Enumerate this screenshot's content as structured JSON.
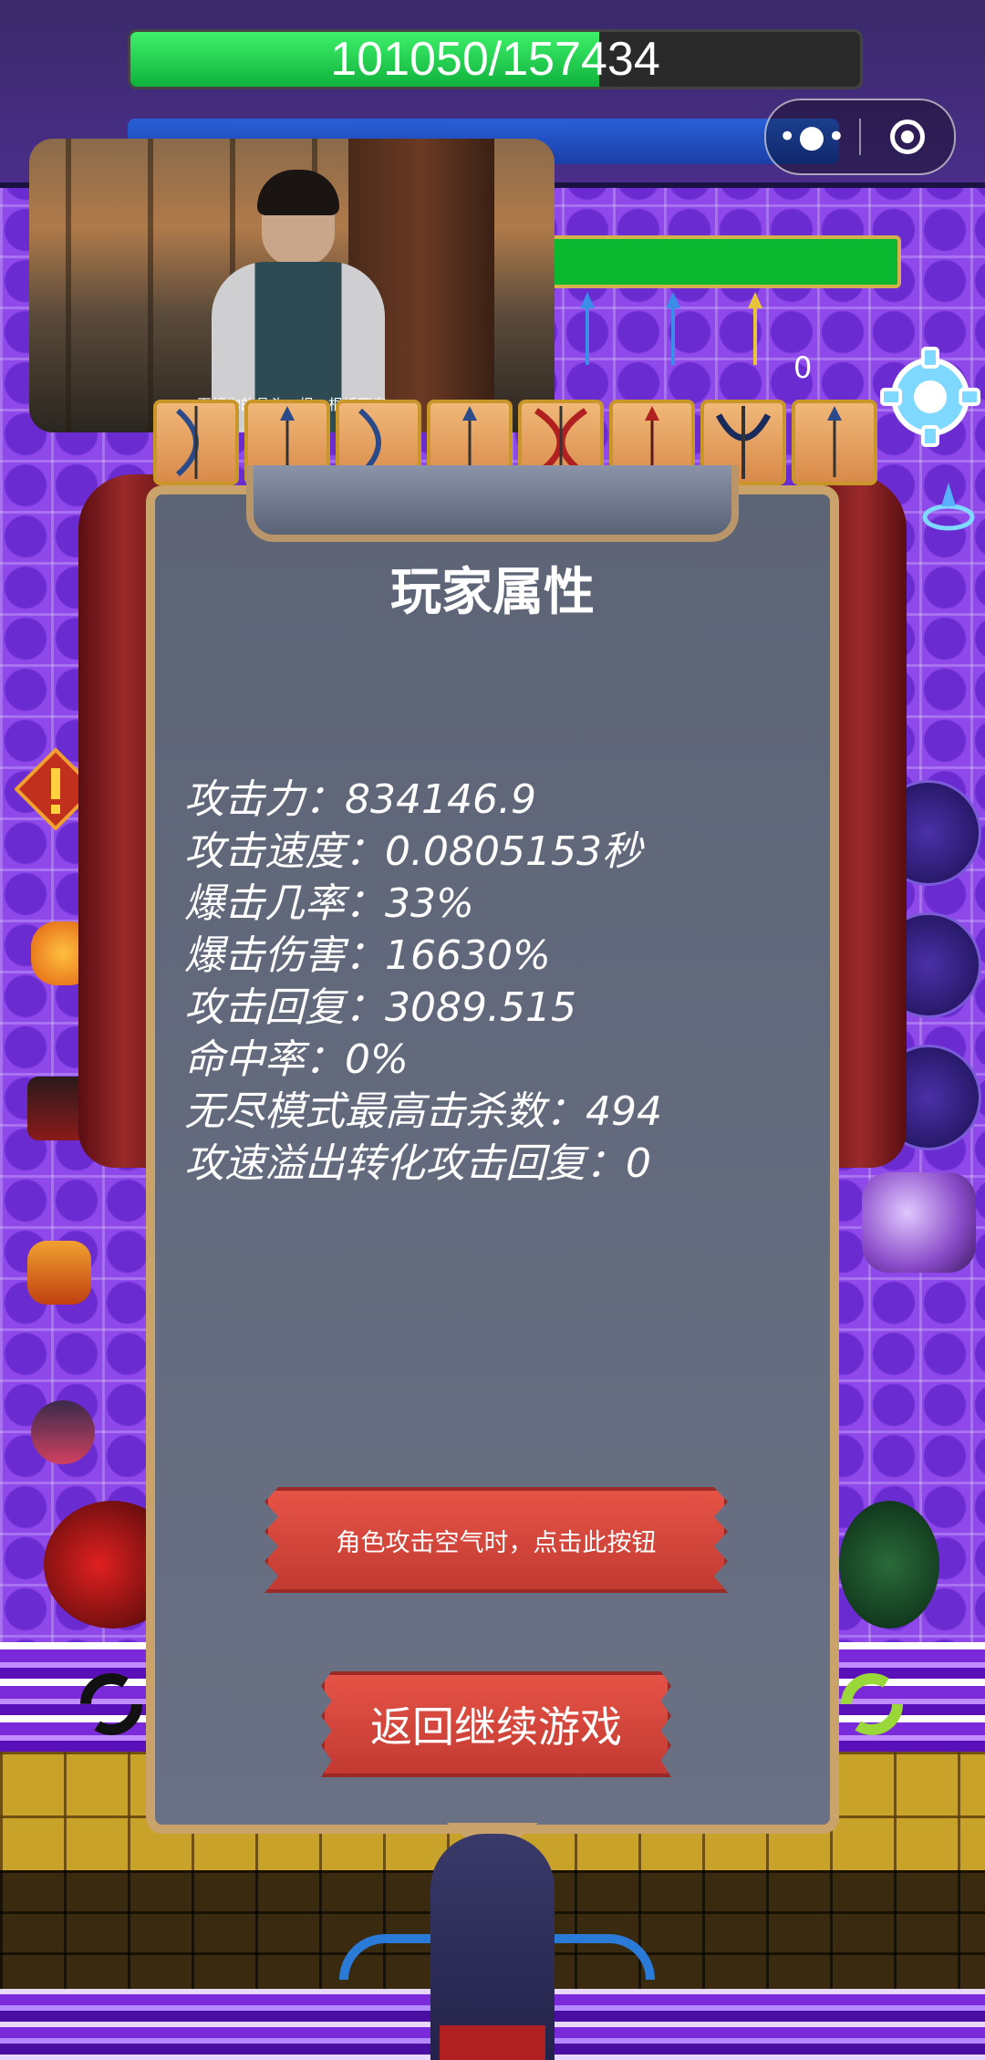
{
  "hud": {
    "hp_text": "101050/157434",
    "hp_fraction": 0.642,
    "blue_bar_text": "",
    "small_counter": "0"
  },
  "video": {
    "subtitle": "再将你的骨头一根一根拆下来"
  },
  "capsule": {
    "more_icon": "more-dots-icon",
    "close_icon": "target-close-icon"
  },
  "panel": {
    "title": "玩家属性",
    "stats": [
      "攻击力：834146.9",
      "攻击速度：0.0805153秒",
      "爆击几率：33%",
      "爆击伤害：16630%",
      "攻击回复：3089.515",
      "命中率：0%",
      "无尽模式最高击杀数：494",
      "攻速溢出转化攻击回复：0"
    ],
    "air_attack_button": "角色攻击空气时，点击此按钮",
    "resume_button": "返回继续游戏"
  },
  "weapon_slots": [
    "bow-icon",
    "arrow-icon",
    "bow-icon",
    "arrow-icon",
    "red-bow-icon",
    "arrow-icon",
    "crossbow-icon",
    "arrow-icon"
  ],
  "colors": {
    "hp_fill": "#1fcc4c",
    "panel_bg": "#5d6476",
    "panel_border": "#c9a36a",
    "button_red": "#d9463c",
    "playfield": "#8f49ea"
  }
}
